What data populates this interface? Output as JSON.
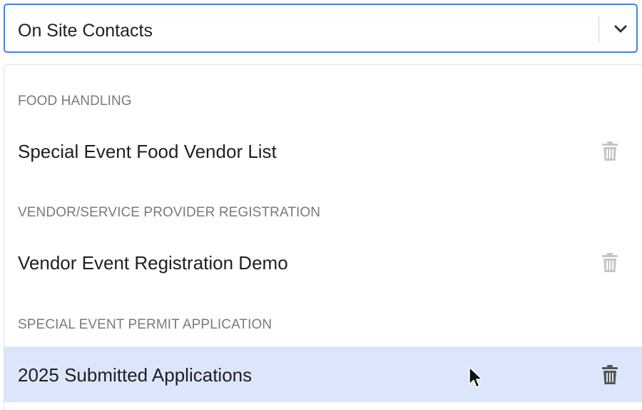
{
  "select": {
    "value": "On Site Contacts",
    "chevron_icon": "chevron-down-icon"
  },
  "dropdown": {
    "groups": [
      {
        "header": "FOOD HANDLING",
        "options": [
          {
            "label": "Special Event Food Vendor List",
            "delete_icon": "trash-icon",
            "active": false
          }
        ]
      },
      {
        "header": "VENDOR/SERVICE PROVIDER REGISTRATION",
        "options": [
          {
            "label": "Vendor Event Registration Demo",
            "delete_icon": "trash-icon",
            "active": false
          }
        ]
      },
      {
        "header": "SPECIAL EVENT PERMIT APPLICATION",
        "options": [
          {
            "label": "2025 Submitted Applications",
            "delete_icon": "trash-icon",
            "active": true
          }
        ]
      }
    ]
  },
  "colors": {
    "focus_border": "#4a7fe0",
    "active_row_bg": "#dbe6fb",
    "trash_muted": "#c6c6c6",
    "trash_active": "#555555",
    "group_header_text": "#7a7a7a"
  }
}
